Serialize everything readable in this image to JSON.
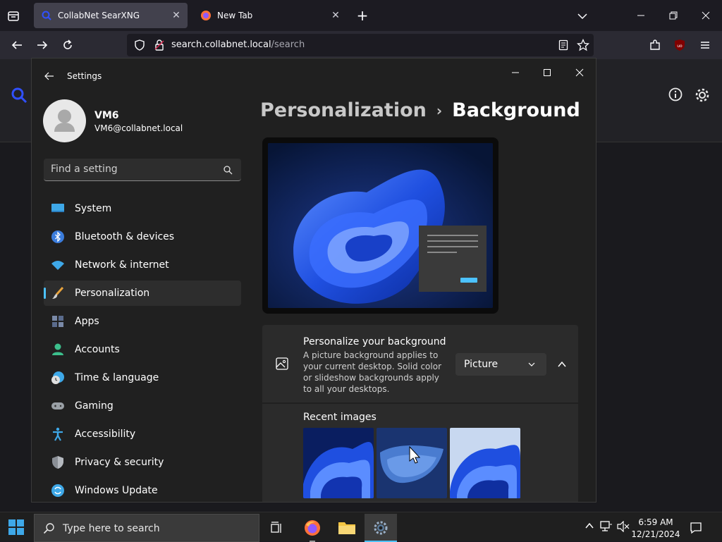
{
  "browser": {
    "tabs": [
      {
        "title": "CollabNet SearXNG",
        "active": true
      },
      {
        "title": "New Tab",
        "active": false
      }
    ],
    "url": {
      "host": "search.collabnet.local",
      "path": "/search"
    }
  },
  "settings": {
    "window_title": "Settings",
    "user": {
      "name": "VM6",
      "email": "VM6@collabnet.local"
    },
    "search_placeholder": "Find a setting",
    "nav_items": [
      {
        "label": "System",
        "icon": "system-icon"
      },
      {
        "label": "Bluetooth & devices",
        "icon": "bluetooth-icon"
      },
      {
        "label": "Network & internet",
        "icon": "wifi-icon"
      },
      {
        "label": "Personalization",
        "icon": "brush-icon",
        "selected": true
      },
      {
        "label": "Apps",
        "icon": "apps-icon"
      },
      {
        "label": "Accounts",
        "icon": "person-icon"
      },
      {
        "label": "Time & language",
        "icon": "clock-globe-icon"
      },
      {
        "label": "Gaming",
        "icon": "gamepad-icon"
      },
      {
        "label": "Accessibility",
        "icon": "accessibility-icon"
      },
      {
        "label": "Privacy & security",
        "icon": "shield-icon"
      },
      {
        "label": "Windows Update",
        "icon": "update-icon"
      }
    ],
    "breadcrumb": {
      "parent": "Personalization",
      "separator": "›",
      "current": "Background"
    },
    "personalize": {
      "title": "Personalize your background",
      "description": "A picture background applies to your current desktop. Solid color or slideshow backgrounds apply to all your desktops.",
      "dropdown_value": "Picture"
    },
    "recent_images_label": "Recent images"
  },
  "taskbar": {
    "search_placeholder": "Type here to search",
    "time": "6:59 AM",
    "date": "12/21/2024"
  },
  "colors": {
    "accent": "#4cc2ff",
    "settings_bg": "#202020",
    "card_bg": "#2b2b2b"
  }
}
